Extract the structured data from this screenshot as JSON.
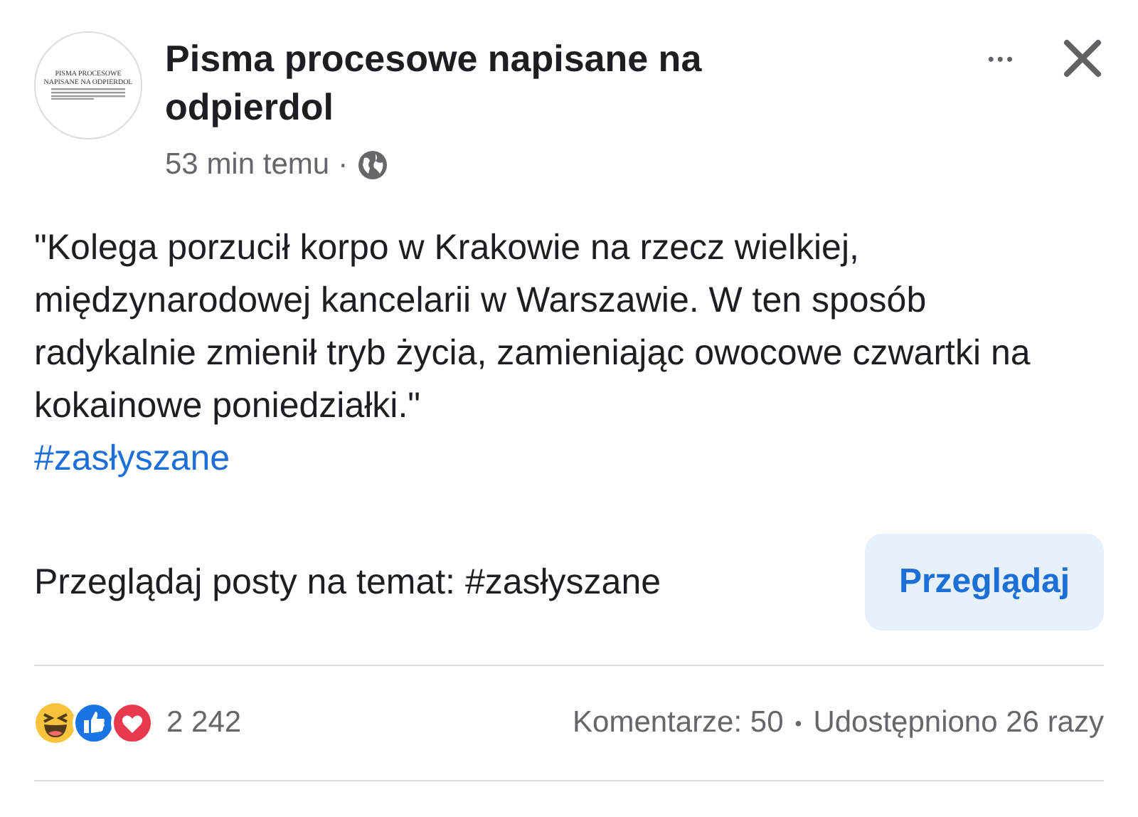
{
  "post": {
    "avatar_text": [
      "PISMA PROCESOWE",
      "NAPISANE NA ODPIERDOL"
    ],
    "author": "Pisma procesowe napisane na odpierdol",
    "time": "53 min temu",
    "separator": "·",
    "more": "•••",
    "body": "\"Kolega porzucił korpo w Krakowie na rzecz wielkiej, międzynarodowej kancelarii w Warszawie. W ten sposób radykalnie zmienił tryb życia, zamieniając owocowe czwartki na kokainowe poniedziałki.\"",
    "hashtag": "#zasłyszane"
  },
  "explore": {
    "text": "Przeglądaj posty na temat: #zasłyszane",
    "button": "Przeglądaj"
  },
  "footer": {
    "reactions": [
      {
        "kind": "haha"
      },
      {
        "kind": "like"
      },
      {
        "kind": "love"
      }
    ],
    "count": "2 242",
    "comments": "Komentarze: 50",
    "dot": "•",
    "shares": "Udostępniono 26 razy"
  }
}
